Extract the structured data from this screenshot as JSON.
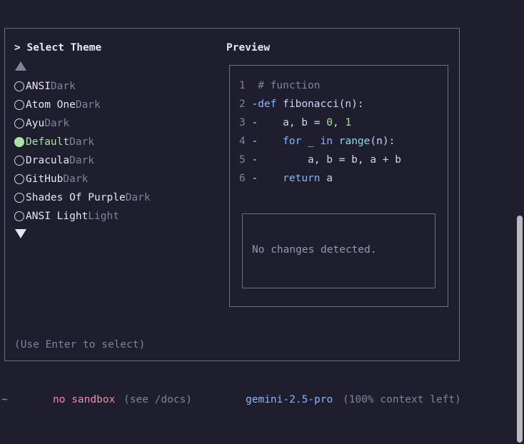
{
  "dialog": {
    "select_title": "> Select Theme",
    "preview_title": "Preview",
    "hint": "(Use Enter to select)",
    "scroll_up_icon": "triangle-up",
    "scroll_down_icon": "triangle-down"
  },
  "themes": [
    {
      "name": "ANSI",
      "variant": "Dark",
      "selected": false
    },
    {
      "name": "Atom One",
      "variant": "Dark",
      "selected": false
    },
    {
      "name": "Ayu",
      "variant": "Dark",
      "selected": false
    },
    {
      "name": "Default",
      "variant": "Dark",
      "selected": true
    },
    {
      "name": "Dracula",
      "variant": "Dark",
      "selected": false
    },
    {
      "name": "GitHub",
      "variant": "Dark",
      "selected": false
    },
    {
      "name": "Shades Of Purple",
      "variant": "Dark",
      "selected": false
    },
    {
      "name": "ANSI Light",
      "variant": "Light",
      "selected": false
    }
  ],
  "preview": {
    "code": [
      {
        "num": "1",
        "marker": " ",
        "tokens": [
          {
            "t": "# function",
            "c": "cm"
          }
        ]
      },
      {
        "num": "2",
        "marker": "-",
        "tokens": [
          {
            "t": "def",
            "c": "kw"
          },
          {
            "t": " fibonacci(n):",
            "c": "fn"
          }
        ]
      },
      {
        "num": "3",
        "marker": "-",
        "tokens": [
          {
            "t": "    a, b = ",
            "c": "tx"
          },
          {
            "t": "0",
            "c": "num"
          },
          {
            "t": ", ",
            "c": "tx"
          },
          {
            "t": "1",
            "c": "num"
          }
        ]
      },
      {
        "num": "4",
        "marker": "-",
        "tokens": [
          {
            "t": "    ",
            "c": "tx"
          },
          {
            "t": "for",
            "c": "kw"
          },
          {
            "t": " _ ",
            "c": "tx"
          },
          {
            "t": "in",
            "c": "kw"
          },
          {
            "t": " ",
            "c": "tx"
          },
          {
            "t": "range",
            "c": "bi"
          },
          {
            "t": "(n):",
            "c": "tx"
          }
        ]
      },
      {
        "num": "5",
        "marker": "-",
        "tokens": [
          {
            "t": "        a, b = b, a + b",
            "c": "tx"
          }
        ]
      },
      {
        "num": "6",
        "marker": "-",
        "tokens": [
          {
            "t": "    ",
            "c": "tx"
          },
          {
            "t": "return",
            "c": "kw"
          },
          {
            "t": " a",
            "c": "tx"
          }
        ]
      }
    ],
    "diff_message": "No changes detected."
  },
  "status": {
    "cwd": "~",
    "sandbox": "no sandbox",
    "sandbox_hint": "(see /docs)",
    "model": "gemini-2.5-pro",
    "context": "(100% context left)"
  },
  "colors": {
    "background": "#1e1e2e",
    "selected": "#a6e3a1",
    "keyword": "#89b4fa",
    "sandbox": "#f38ba8",
    "muted": "#7f849c"
  }
}
